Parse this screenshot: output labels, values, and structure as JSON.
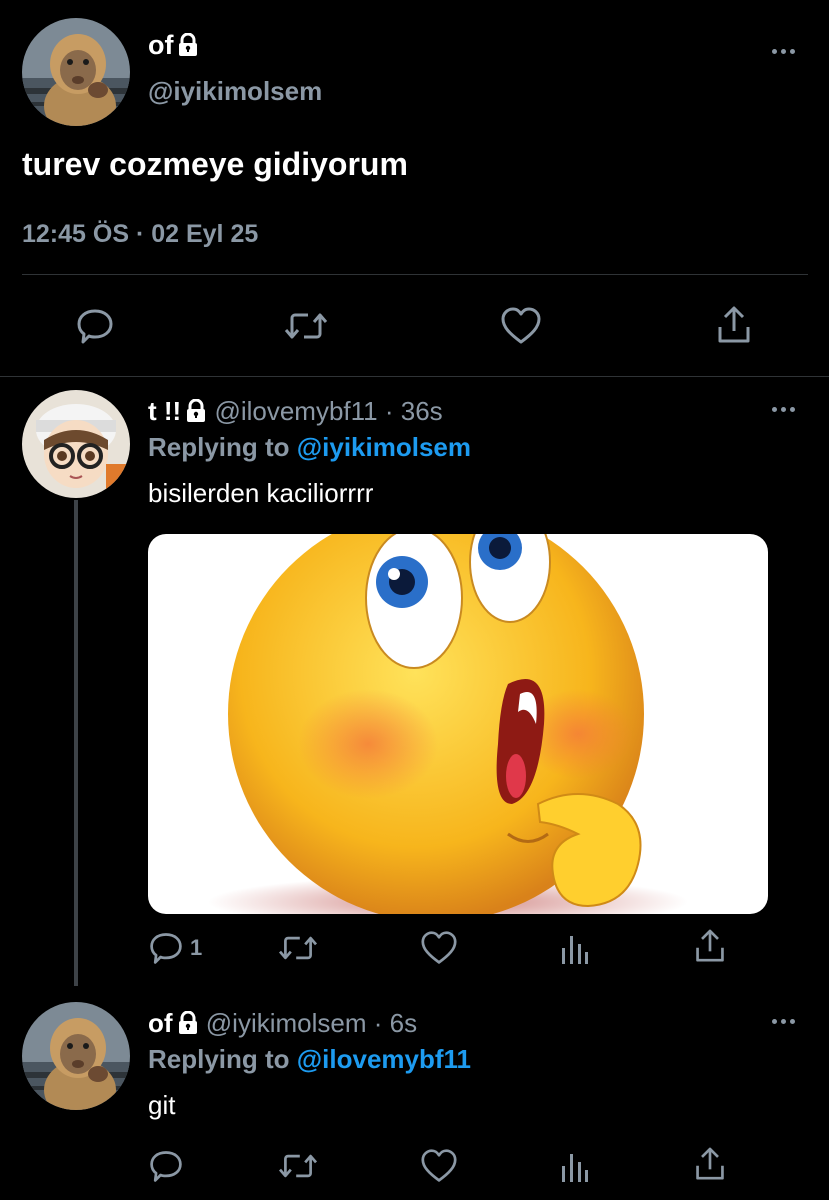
{
  "main_tweet": {
    "display_name": "of",
    "handle": "@iyikimolsem",
    "text": "turev cozmeye gidiyorum",
    "timestamp": "12:45 ÖS · 02 Eyl 25",
    "avatar_icon": "monkey-avatar"
  },
  "reply1": {
    "display_name": "t !!",
    "handle": "@ilovemybf11",
    "time": "· 36s",
    "replying_label": "Replying to",
    "replying_to": "@iyikimolsem",
    "text": "bisilerden kaciliorrrr",
    "media_icon": "shy-emoji-image",
    "reply_count": "1",
    "avatar_icon": "anime-girl-avatar"
  },
  "reply2": {
    "display_name": "of",
    "handle": "@iyikimolsem",
    "time": "· 6s",
    "replying_label": "Replying to",
    "replying_to": "@ilovemybf11",
    "text": "git",
    "avatar_icon": "monkey-avatar"
  },
  "colors": {
    "background": "#000000",
    "secondary_text": "#8b98a5",
    "link": "#1d9bf0",
    "divider": "#2f3336"
  }
}
